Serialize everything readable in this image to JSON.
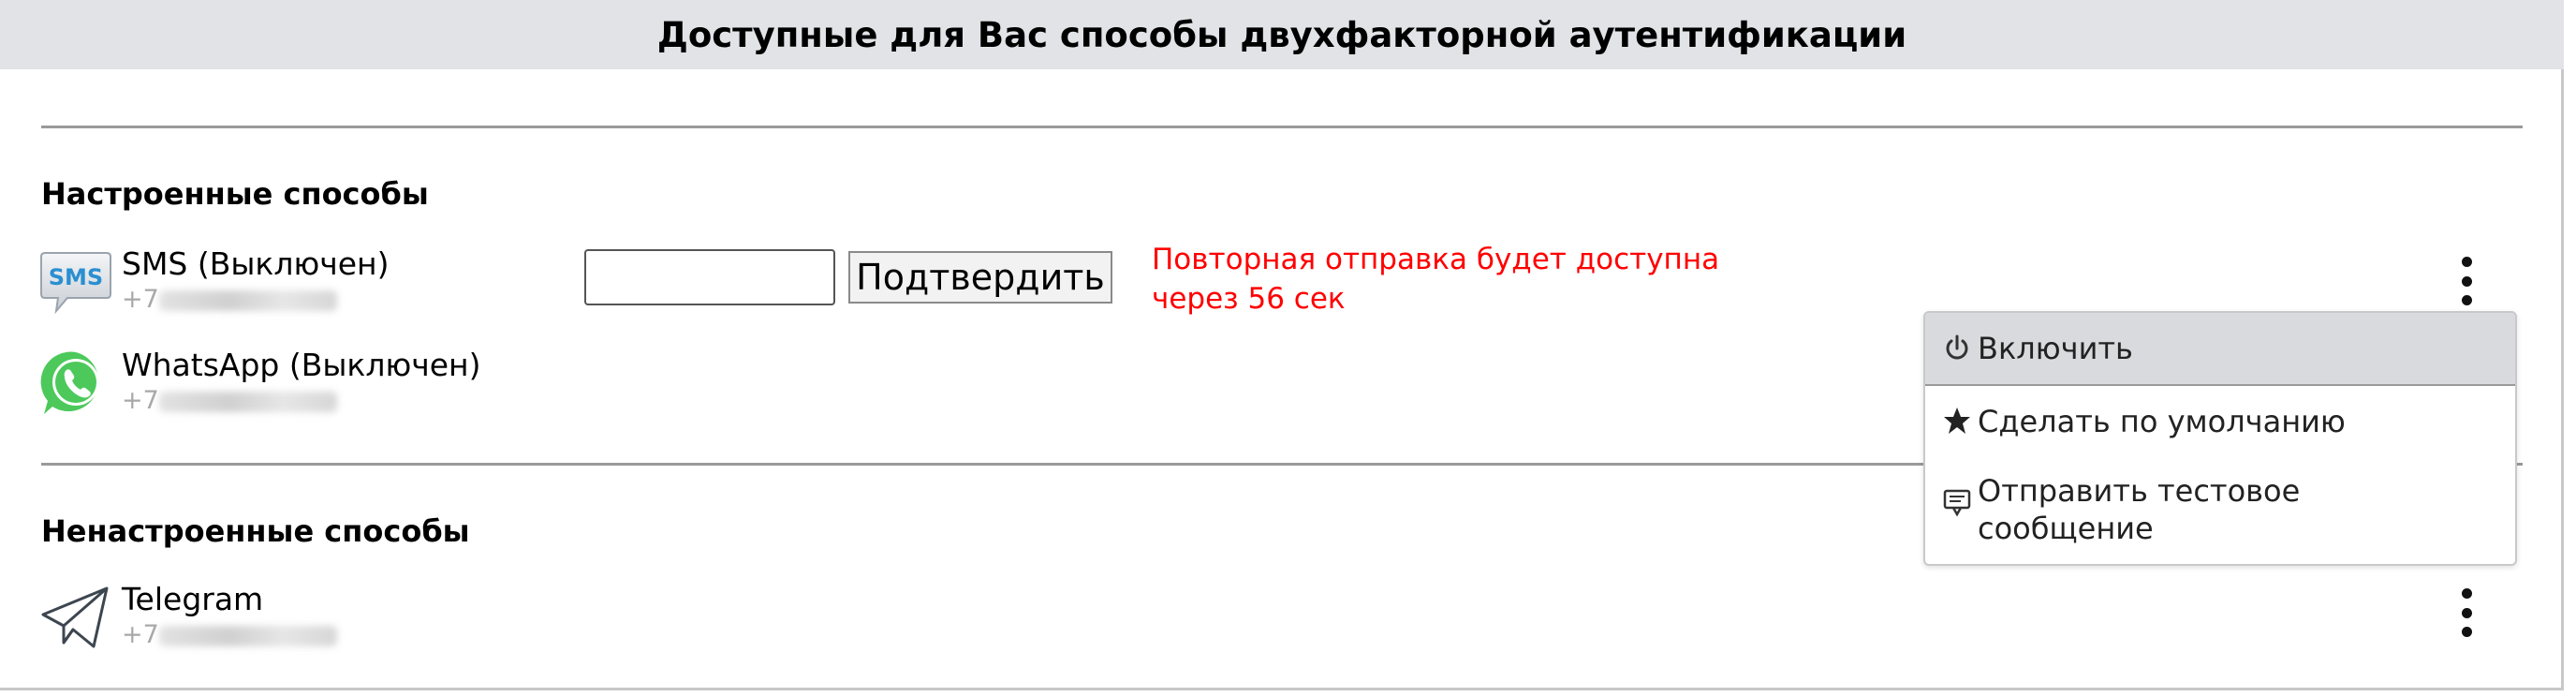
{
  "header": {
    "title": "Доступные для Вас способы двухфакторной аутентификации"
  },
  "configured": {
    "title": "Настроенные способы",
    "methods": [
      {
        "name": "SMS (Выключен)",
        "phone_prefix": "+7",
        "icon": "sms-icon",
        "icon_text": "SMS"
      },
      {
        "name": "WhatsApp (Выключен)",
        "phone_prefix": "+7",
        "icon": "whatsapp-icon"
      }
    ]
  },
  "verification": {
    "code_value": "",
    "confirm_label": "Подтвердить",
    "resend_note": "Повторная отправка будет доступна через 56 сек"
  },
  "unconfigured": {
    "title": "Ненастроенные способы",
    "methods": [
      {
        "name": "Telegram",
        "phone_prefix": "+7",
        "icon": "telegram-icon"
      }
    ]
  },
  "menu": {
    "items": [
      {
        "label": "Включить",
        "icon": "power-icon",
        "active": true
      },
      {
        "label": "Сделать по умолчанию",
        "icon": "star-icon",
        "active": false
      },
      {
        "label": "Отправить тестовое сообщение",
        "icon": "message-icon",
        "active": false
      }
    ]
  },
  "colors": {
    "header_bg": "#e1e3e7",
    "warning": "#ff0000",
    "whatsapp": "#4cc95a",
    "sms_blue": "#2a8fd1"
  }
}
